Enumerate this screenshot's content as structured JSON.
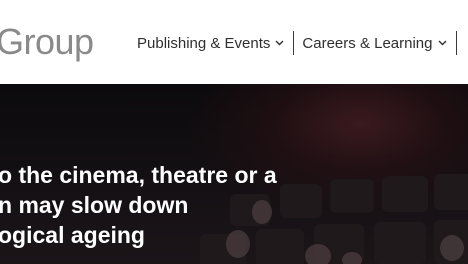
{
  "header": {
    "brand_text": "Group",
    "nav": [
      {
        "label": "Publishing & Events"
      },
      {
        "label": "Careers & Learning"
      }
    ]
  },
  "hero": {
    "headline_lines": [
      "o the cinema, theatre or a",
      "n may slow down",
      "ogical ageing"
    ]
  },
  "icons": {
    "nav_chevron": "chevron-down-icon"
  },
  "colors": {
    "brand": "#8a8a8a",
    "nav_text": "#2f2f2f",
    "hero_text": "#ffffff",
    "hero_bg": "#141013"
  }
}
